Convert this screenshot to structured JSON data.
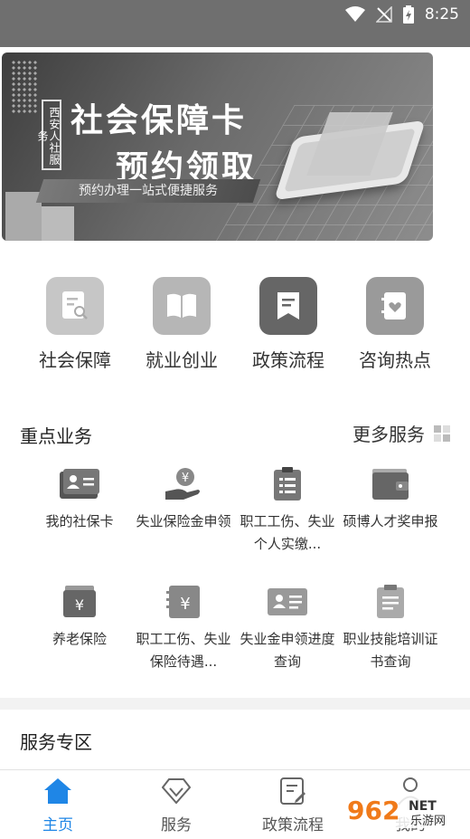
{
  "status_bar": {
    "time": "8:25"
  },
  "banner": {
    "vertical_tag": "西安人社服务",
    "title_line1": "社会保障卡",
    "title_line2": "预约领取",
    "subtitle": "预约办理一站式便捷服务"
  },
  "categories": [
    {
      "label": "社会保障",
      "icon": "social-security-icon"
    },
    {
      "label": "就业创业",
      "icon": "book-icon"
    },
    {
      "label": "政策流程",
      "icon": "document-bookmark-icon"
    },
    {
      "label": "咨询热点",
      "icon": "heart-notebook-icon"
    }
  ],
  "key_services": {
    "title": "重点业务",
    "more_label": "更多服务",
    "items": [
      {
        "label": "我的社保卡",
        "icon": "id-card-icon"
      },
      {
        "label": "失业保险金申领",
        "icon": "money-hand-icon"
      },
      {
        "label": "职工工伤、失业个人实缴...",
        "icon": "clipboard-icon"
      },
      {
        "label": "硕博人才奖申报",
        "icon": "wallet-icon"
      },
      {
        "label": "养老保险",
        "icon": "yuan-box-icon"
      },
      {
        "label": "职工工伤、失业保险待遇...",
        "icon": "yuan-notebook-icon"
      },
      {
        "label": "失业金申领进度查询",
        "icon": "id-card-icon"
      },
      {
        "label": "职业技能培训证书查询",
        "icon": "certificate-icon"
      }
    ]
  },
  "service_zone": {
    "title": "服务专区"
  },
  "tabbar": [
    {
      "label": "主页",
      "icon": "home-icon",
      "active": true
    },
    {
      "label": "服务",
      "icon": "diamond-icon",
      "active": false
    },
    {
      "label": "政策流程",
      "icon": "document-edit-icon",
      "active": false
    },
    {
      "label": "我的",
      "icon": "user-icon",
      "active": false
    }
  ],
  "watermark": {
    "text": "962",
    "suffix": "NET",
    "caption": "乐游网"
  },
  "colors": {
    "accent": "#1f86e6",
    "status_bar": "#6f6f6f"
  }
}
